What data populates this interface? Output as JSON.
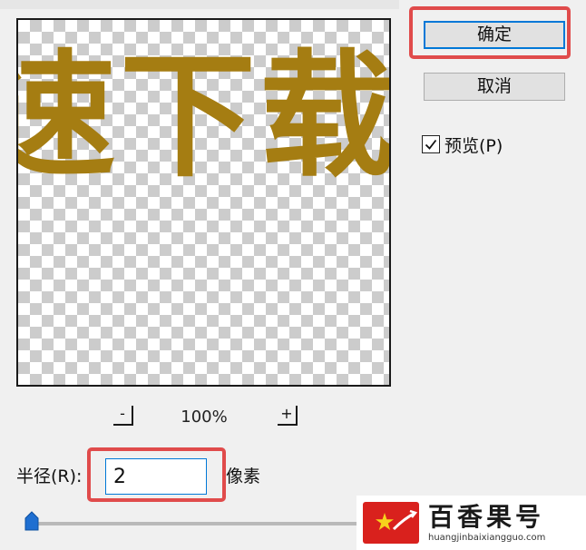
{
  "preview": {
    "sample_text": "速下载",
    "text_color": "#a57d12"
  },
  "zoom": {
    "out_label": "-",
    "level": "100%",
    "in_label": "+"
  },
  "buttons": {
    "ok_label": "确定",
    "cancel_label": "取消"
  },
  "preview_checkbox": {
    "label": "预览(P)",
    "checked": true
  },
  "radius": {
    "label": "半径(R):",
    "value": "2",
    "unit": "像素",
    "slider_value": 2
  },
  "highlight_color": "#e04b4b",
  "accent_color": "#0078d7",
  "watermark": {
    "name": "百香果号",
    "url": "huangjinbaixiangguo.com"
  },
  "icons": {
    "checkbox": "check-icon",
    "slider": "slider-thumb-icon",
    "logo": "star-logo-icon"
  }
}
